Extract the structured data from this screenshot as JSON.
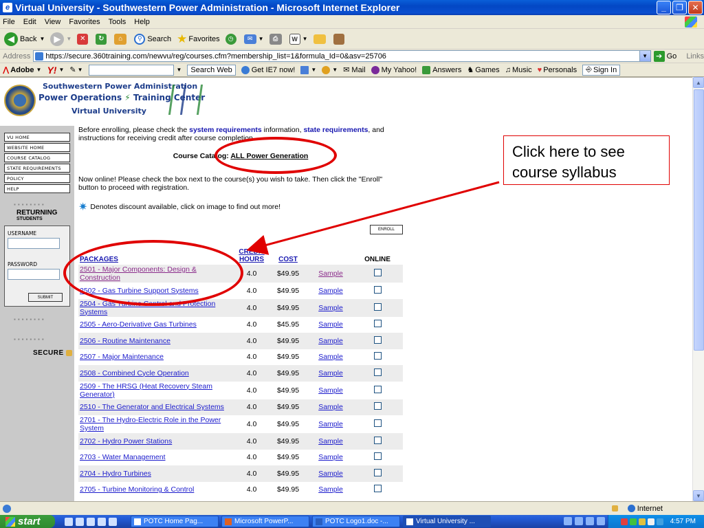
{
  "window": {
    "title": "Virtual University - Southwestern Power Administration - Microsoft Internet Explorer"
  },
  "menu": [
    "File",
    "Edit",
    "View",
    "Favorites",
    "Tools",
    "Help"
  ],
  "toolbar": {
    "back": "Back",
    "search": "Search",
    "favorites": "Favorites"
  },
  "address": {
    "label": "Address",
    "url": "https://secure.360training.com/newvu/reg/courses.cfm?membership_list=1&formula_Id=0&asv=25706",
    "go": "Go",
    "links": "Links"
  },
  "linksbar": {
    "adobe": "Adobe",
    "yahoo": "Y!",
    "search_web": "Search Web",
    "get_ie7": "Get IE7 now!",
    "mail": "Mail",
    "my_yahoo": "My Yahoo!",
    "answers": "Answers",
    "games": "Games",
    "music": "Music",
    "personals": "Personals",
    "sign_in": "Sign In"
  },
  "logo": {
    "line1": "Southwestern Power Administration",
    "line2a": "Power Operations",
    "line2b": "Training Center",
    "line3": "Virtual University"
  },
  "nav": {
    "items": [
      "VU HOME",
      "WEBSITE HOME",
      "COURSE CATALOG",
      "STATE REQUIREMENTS",
      "POLICY",
      "HELP"
    ],
    "returning": "RETURNING",
    "students": "STUDENTS",
    "username_label": "USERNAME",
    "password_label": "PASSWORD",
    "submit": "SUBMIT",
    "secure": "SECURE"
  },
  "intro": {
    "p1_a": "Before enrolling, please check the ",
    "p1_link1": "system requirements",
    "p1_b": " information, ",
    "p1_link2": "state requirements",
    "p1_c": ", and instructions for receiving credit after course completion.",
    "catalog_label": "Course Catalog: ",
    "catalog_link": "ALL Power Generation",
    "p2": "Now online! Please check the box next to the course(s) you wish to take. Then click the \"Enroll\" button to proceed with registration.",
    "p3": "Denotes discount available, click on image to find out more!",
    "enroll": "ENROLL"
  },
  "table": {
    "headers": {
      "packages": "PACKAGES",
      "credit_hours": "CREDIT HOURS",
      "cost": "COST",
      "online": "ONLINE"
    },
    "rows": [
      {
        "name": "2501 - Major Components: Design & Construction",
        "hours": "4.0",
        "cost": "$49.95",
        "sample": "Sample"
      },
      {
        "name": "2502 - Gas Turbine Support Systems",
        "hours": "4.0",
        "cost": "$49.95",
        "sample": "Sample"
      },
      {
        "name": "2504 - Gas Turbine Control and Protection Systems",
        "hours": "4.0",
        "cost": "$49.95",
        "sample": "Sample"
      },
      {
        "name": "2505 - Aero-Derivative Gas Turbines",
        "hours": "4.0",
        "cost": "$45.95",
        "sample": "Sample"
      },
      {
        "name": "2506 - Routine Maintenance",
        "hours": "4.0",
        "cost": "$49.95",
        "sample": "Sample"
      },
      {
        "name": "2507 - Major Maintenance",
        "hours": "4.0",
        "cost": "$49.95",
        "sample": "Sample"
      },
      {
        "name": "2508 - Combined Cycle Operation",
        "hours": "4.0",
        "cost": "$49.95",
        "sample": "Sample"
      },
      {
        "name": "2509 - The HRSG (Heat Recovery Steam Generator)",
        "hours": "4.0",
        "cost": "$49.95",
        "sample": "Sample"
      },
      {
        "name": "2510 - The Generator and Electrical Systems",
        "hours": "4.0",
        "cost": "$49.95",
        "sample": "Sample"
      },
      {
        "name": "2701 - The Hydro-Electric Role in the Power System",
        "hours": "4.0",
        "cost": "$49.95",
        "sample": "Sample"
      },
      {
        "name": "2702 - Hydro Power Stations",
        "hours": "4.0",
        "cost": "$49.95",
        "sample": "Sample"
      },
      {
        "name": "2703 - Water Management",
        "hours": "4.0",
        "cost": "$49.95",
        "sample": "Sample"
      },
      {
        "name": "2704 - Hydro Turbines",
        "hours": "4.0",
        "cost": "$49.95",
        "sample": "Sample"
      },
      {
        "name": "2705 - Turbine Monitoring & Control",
        "hours": "4.0",
        "cost": "$49.95",
        "sample": "Sample"
      }
    ]
  },
  "annotation": {
    "callout": "Click here to see course syllabus"
  },
  "status": {
    "zone": "Internet"
  },
  "taskbar": {
    "start": "start",
    "tasks": [
      "POTC Home Pag...",
      "Microsoft PowerP...",
      "POTC Logo1.doc -...",
      "Virtual University ..."
    ],
    "clock": "4:57 PM"
  },
  "colors": {
    "annotation_red": "#e00000",
    "link_blue": "#1a1acc",
    "visited_purple": "#8a2a8a",
    "xp_blue": "#0a4fd0"
  }
}
